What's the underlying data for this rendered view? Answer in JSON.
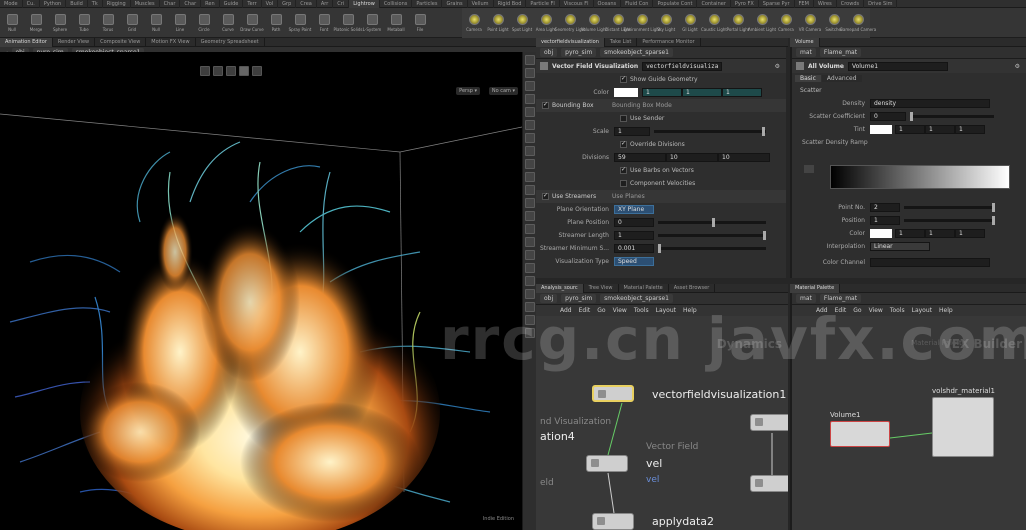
{
  "shelf_tabs": [
    "Mode",
    "Cu.",
    "Python",
    "Build",
    "Tk",
    "Rigging",
    "Muscles",
    "Char",
    "Char",
    "Ren",
    "Guide",
    "Terr",
    "Vol",
    "Grp",
    "Crea",
    "Arr",
    "Cri",
    "Lightrow",
    "Collisions",
    "Particles",
    "Grains",
    "Vellum",
    "Rigid Bod",
    "Particle Fl",
    "Viscous Fl",
    "Oceans",
    "Fluid Con",
    "Populate Cont",
    "Container",
    "Pyro FX",
    "Sparse Pyr",
    "FEM",
    "Wires",
    "Crowds",
    "Drive Sim"
  ],
  "shelf_tools": [
    "Null",
    "Merge",
    "Sphere",
    "Tube",
    "Torus",
    "Grid",
    "Null",
    "Line",
    "Circle",
    "Curve",
    "Draw Curve",
    "Path",
    "Spray Paint",
    "Font",
    "Platonic Solids",
    "L-System",
    "Metaball",
    "File"
  ],
  "light_tools": [
    "Camera",
    "Point Light",
    "Spot Light",
    "Area Light",
    "Geometry Light",
    "Volume Light",
    "Distant Light",
    "Environment Light",
    "Sky Light",
    "GI Light",
    "Caustic Light",
    "Portal Light",
    "Ambient Light",
    "Camera",
    "VR Camera",
    "Switcher",
    "Gamepad Camera"
  ],
  "viewport": {
    "tabs": [
      "Animation Editor",
      "Render View",
      "Composite View",
      "Motion FX View",
      "Geometry Spreadsheet"
    ],
    "path_obj": "obj",
    "path_node1": "pyro_sim",
    "path_node2": "smokeobject_sparse1",
    "persp": "Persp ▾",
    "cam": "No cam ▾",
    "status": "Indie Edition"
  },
  "params": {
    "tabs": [
      "vectorfieldvisualization",
      "Take List",
      "Performance Monitor"
    ],
    "path_obj": "obj",
    "path_node1": "pyro_sim",
    "path_node2": "smokeobject_sparse1",
    "node_type": "Vector Field Visualization",
    "node_name": "vectorfieldvisualiza",
    "show_guide": "Show Guide Geometry",
    "color_label": "Color",
    "color_values": [
      "1",
      "1",
      "1"
    ],
    "bounding_box": "Bounding Box",
    "bounding_box_mode": "Bounding Box Mode",
    "use_sender": "Use Sender",
    "scale_label": "Scale",
    "scale_value": "1",
    "override_divisions": "Override Divisions",
    "divisions_label": "Divisions",
    "divisions_values": [
      "59",
      "10",
      "10"
    ],
    "use_barbs": "Use Barbs on Vectors",
    "component_velocities": "Component Velocities",
    "use_streamers": "Use Streamers",
    "use_planes": "Use Planes",
    "plane_orientation": "Plane Orientation",
    "plane_orientation_value": "XY Plane",
    "plane_position": "Plane Position",
    "plane_position_value": "0",
    "streamer_length": "Streamer Length",
    "streamer_length_value": "1",
    "streamer_minimum": "Streamer Minimum S...",
    "streamer_minimum_value": "0.001",
    "visualization_type": "Visualization Type",
    "visualization_type_value": "Speed"
  },
  "material": {
    "tabs": [
      "Volume"
    ],
    "path_node": "mat",
    "path_node2": "Flame_mat",
    "node_type": "All Volume",
    "node_name": "Volume1",
    "tab_basic": "Basic",
    "tab_advanced": "Advanced",
    "section_scatter": "Scatter",
    "density_label": "Density",
    "density_value": "density",
    "scatter_coef_label": "Scatter Coefficient",
    "scatter_coef_value": "0",
    "tint_label": "Tint",
    "tint_values": [
      "1",
      "1",
      "1"
    ],
    "ramp_label": "Scatter Density Ramp",
    "point_no_label": "Point No.",
    "point_no_value": "2",
    "position_label": "Position",
    "position_value": "1",
    "color_label": "Color",
    "color_values": [
      "1",
      "1",
      "1"
    ],
    "interp_label": "Interpolation",
    "interp_value": "Linear",
    "color_channel_label": "Color Channel"
  },
  "net1": {
    "tabs": [
      "Analysis_sourc",
      "Tree View",
      "Material Palette",
      "Asset Browser"
    ],
    "path_obj": "obj",
    "path_node1": "pyro_sim",
    "path_node2": "smokeobject_sparse1",
    "menu": [
      "Add",
      "Edit",
      "Go",
      "View",
      "Tools",
      "Layout",
      "Help"
    ],
    "context_label": "Dynamics",
    "node1": "vectorfieldvisualization1",
    "node2_type": "Vector Field",
    "node2": "vel",
    "node2_sub": "vel",
    "node3": "applydata2",
    "partial1": "nd Visualization",
    "partial2": "ation4",
    "partial3": "eld"
  },
  "net2": {
    "tabs": [
      "Material Palette"
    ],
    "path_node": "mat",
    "path_node2": "Flame_mat",
    "menu": [
      "Add",
      "Edit",
      "Go",
      "View",
      "Tools",
      "Layout",
      "Help"
    ],
    "context_label": "VEX Builder",
    "context_sub": "Material Palette",
    "node1": "Volume1",
    "node2": "volshdr_material1"
  },
  "watermark": "rrcg.cn   javfx.com"
}
